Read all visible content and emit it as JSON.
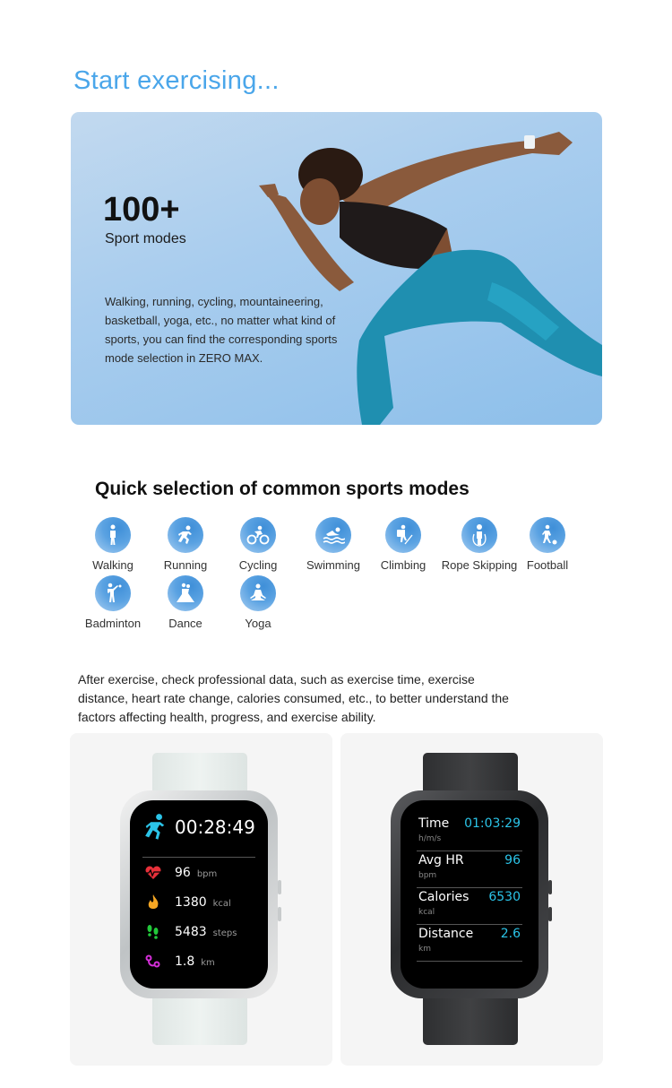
{
  "hero": {
    "title": "Start exercising...",
    "count": "100+",
    "count_label": "Sport modes",
    "description": "Walking, running, cycling, mountaineering, basketball, yoga, etc., no matter what kind of sports, you can find the corresponding sports mode selection in ZERO MAX."
  },
  "quick_selection": {
    "title": "Quick selection of common sports modes",
    "sports": [
      {
        "label": "Walking",
        "icon": "walking-icon"
      },
      {
        "label": "Running",
        "icon": "running-icon"
      },
      {
        "label": "Cycling",
        "icon": "cycling-icon"
      },
      {
        "label": "Swimming",
        "icon": "swimming-icon"
      },
      {
        "label": "Climbing",
        "icon": "climbing-icon"
      },
      {
        "label": "Rope Skipping",
        "icon": "rope-skipping-icon"
      },
      {
        "label": "Football",
        "icon": "football-icon"
      },
      {
        "label": "Badminton",
        "icon": "badminton-icon"
      },
      {
        "label": "Dance",
        "icon": "dance-icon"
      },
      {
        "label": "Yoga",
        "icon": "yoga-icon"
      }
    ]
  },
  "after_exercise": {
    "text": "After exercise, check professional data, such as exercise time, exercise distance, heart rate change, calories consumed, etc., to better understand the factors affecting health, progress, and exercise ability."
  },
  "watch_silver": {
    "timer": "00:28:49",
    "stats": [
      {
        "icon": "heart-rate-icon",
        "value": "96",
        "unit": "bpm",
        "color": "#e8303a"
      },
      {
        "icon": "flame-icon",
        "value": "1380",
        "unit": "kcal",
        "color": "#f5a623"
      },
      {
        "icon": "footsteps-icon",
        "value": "5483",
        "unit": "steps",
        "color": "#22c83a"
      },
      {
        "icon": "route-icon",
        "value": "1.8",
        "unit": "km",
        "color": "#d42fd8"
      }
    ],
    "accent": "#2bc4e8"
  },
  "watch_black": {
    "metrics": [
      {
        "label": "Time",
        "value": "01:03:29",
        "unit": "h/m/s"
      },
      {
        "label": "Avg HR",
        "value": "96",
        "unit": "bpm"
      },
      {
        "label": "Calories",
        "value": "6530",
        "unit": "kcal"
      },
      {
        "label": "Distance",
        "value": "2.6",
        "unit": "km"
      }
    ],
    "accent": "#2bc4e8"
  }
}
